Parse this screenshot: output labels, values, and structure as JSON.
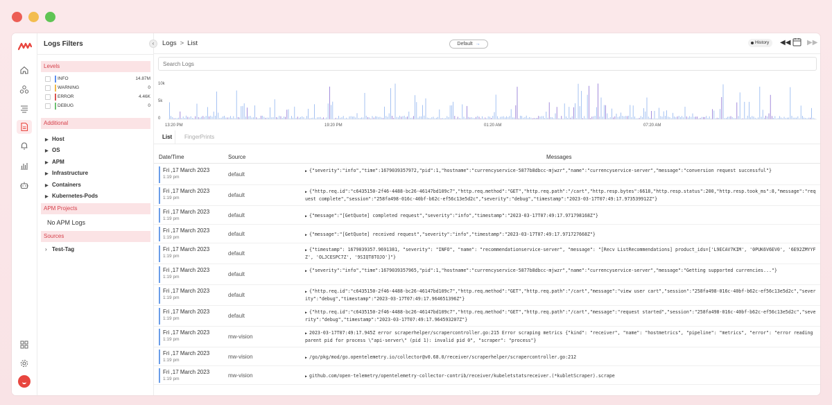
{
  "window_controls": {
    "close_color": "#ec5e55",
    "minimize_color": "#f3bd4f",
    "maximize_color": "#5fc454"
  },
  "brand_color": "#e8463f",
  "filters": {
    "title": "Logs Filters",
    "levels_header": "Levels",
    "levels": [
      {
        "name": "INFO",
        "count": "14.87M",
        "color": "#5b8def"
      },
      {
        "name": "WARNING",
        "count": "0",
        "color": "#f0b94a"
      },
      {
        "name": "ERROR",
        "count": "4.46K",
        "color": "#d9534f"
      },
      {
        "name": "DEBUG",
        "count": "0",
        "color": "#6cc070"
      }
    ],
    "additional_header": "Additional",
    "additional": [
      "Host",
      "OS",
      "APM",
      "Infrastructure",
      "Containers",
      "Kubernetes-Pods"
    ],
    "apm_header": "APM Projects",
    "apm_empty": "No APM Logs",
    "sources_header": "Sources",
    "sources": [
      "Test-Tag"
    ]
  },
  "topbar": {
    "crumb_root": "Logs",
    "crumb_sep": ">",
    "crumb_current": "List",
    "view": "Default",
    "history": "History"
  },
  "search": {
    "placeholder": "Search Logs"
  },
  "chart_data": {
    "type": "bar",
    "y_ticks": [
      "10k",
      "5k",
      "0"
    ],
    "ylim": [
      0,
      10000
    ],
    "x_ticks": [
      "13:20 PM",
      "19:20 PM",
      "01:20 AM",
      "07:20 AM"
    ]
  },
  "tabs": {
    "list": "List",
    "fingerprints": "FingerPrints"
  },
  "table": {
    "headers": {
      "date": "Date/Time",
      "source": "Source",
      "messages": "Messages"
    },
    "rows": [
      {
        "date": "Fri ,17 March 2023",
        "time": "1:19 pm",
        "source": "default",
        "lines": 2,
        "message": "{\"severity\":\"info\",\"time\":1679039357972,\"pid\":1,\"hostname\":\"currencyservice-5877b8dbcc-mjwzr\",\"name\":\"currencyservice-server\",\"message\":\"conversion request successful\"}"
      },
      {
        "date": "Fri ,17 March 2023",
        "time": "1:19 pm",
        "source": "default",
        "lines": 2,
        "message": "{\"http.req.id\":\"c6435150-2f46-4488-bc26-46147bd109c7\",\"http.req.method\":\"GET\",\"http.req.path\":\"/cart\",\"http.resp.bytes\":6618,\"http.resp.status\":200,\"http.resp.took_ms\":8,\"message\":\"request complete\",\"session\":\"258fa498-016c-40bf-b62c-ef56c13e5d2c\",\"severity\":\"debug\",\"timestamp\":\"2023-03-17T07:49:17.973539912Z\"}"
      },
      {
        "date": "Fri ,17 March 2023",
        "time": "1:19 pm",
        "source": "default",
        "lines": 1,
        "message": "{\"message\":\"[GetQuote] completed request\",\"severity\":\"info\",\"timestamp\":\"2023-03-17T07:49:17.971798168Z\"}"
      },
      {
        "date": "Fri ,17 March 2023",
        "time": "1:19 pm",
        "source": "default",
        "lines": 1,
        "message": "{\"message\":\"[GetQuote] received request\",\"severity\":\"info\",\"timestamp\":\"2023-03-17T07:49:17.971727668Z\"}"
      },
      {
        "date": "Fri ,17 March 2023",
        "time": "1:19 pm",
        "source": "default",
        "lines": 2,
        "message": "{\"timestamp\": 1679039357.9691381, \"severity\": \"INFO\", \"name\": \"recommendationservice-server\", \"message\": \"[Recv ListRecommendations] product_ids=['L9ECAV7KIM', '0PUK6V6EV0', '6E92ZMYYFZ', 'OLJCESPC7Z', '9SIQT8TOJO']\"}"
      },
      {
        "date": "Fri ,17 March 2023",
        "time": "1:19 pm",
        "source": "default",
        "lines": 2,
        "message": "{\"severity\":\"info\",\"time\":1679039357965,\"pid\":1,\"hostname\":\"currencyservice-5877b8dbcc-mjwzr\",\"name\":\"currencyservice-server\",\"message\":\"Getting supported currencies...\"}"
      },
      {
        "date": "Fri ,17 March 2023",
        "time": "1:19 pm",
        "source": "default",
        "lines": 2,
        "message": "{\"http.req.id\":\"c6435150-2f46-4488-bc26-46147bd109c7\",\"http.req.method\":\"GET\",\"http.req.path\":\"/cart\",\"message\":\"view user cart\",\"session\":\"258fa498-016c-40bf-b62c-ef56c13e5d2c\",\"severity\":\"debug\",\"timestamp\":\"2023-03-17T07:49:17.964651396Z\"}"
      },
      {
        "date": "Fri ,17 March 2023",
        "time": "1:19 pm",
        "source": "default",
        "lines": 2,
        "message": "{\"http.req.id\":\"c6435150-2f46-4488-bc26-46147bd109c7\",\"http.req.method\":\"GET\",\"http.req.path\":\"/cart\",\"message\":\"request started\",\"session\":\"258fa498-016c-40bf-b62c-ef56c13e5d2c\",\"severity\":\"debug\",\"timestamp\":\"2023-03-17T07:49:17.964593207Z\"}"
      },
      {
        "date": "Fri ,17 March 2023",
        "time": "1:19 pm",
        "source": "mw-vision",
        "lines": 2,
        "message": "2023-03-17T07:49:17.945Z error scraperhelper/scrapercontroller.go:215 Error scraping metrics {\"kind\": \"receiver\", \"name\": \"hostmetrics\", \"pipeline\": \"metrics\", \"error\": \"error reading parent pid for process \\\"api-server\\\" (pid 1): invalid pid 0\", \"scraper\": \"process\"}"
      },
      {
        "date": "Fri ,17 March 2023",
        "time": "1:19 pm",
        "source": "mw-vision",
        "lines": 1,
        "message": "/go/pkg/mod/go.opentelemetry.io/collector@v0.68.0/receiver/scraperhelper/scrapercontroller.go:212"
      },
      {
        "date": "Fri ,17 March 2023",
        "time": "1:19 pm",
        "source": "mw-vision",
        "lines": 1,
        "message": "github.com/open-telemetry/opentelemetry-collector-contrib/receiver/kubeletstatsreceiver.(*kubletScraper).scrape"
      }
    ]
  }
}
